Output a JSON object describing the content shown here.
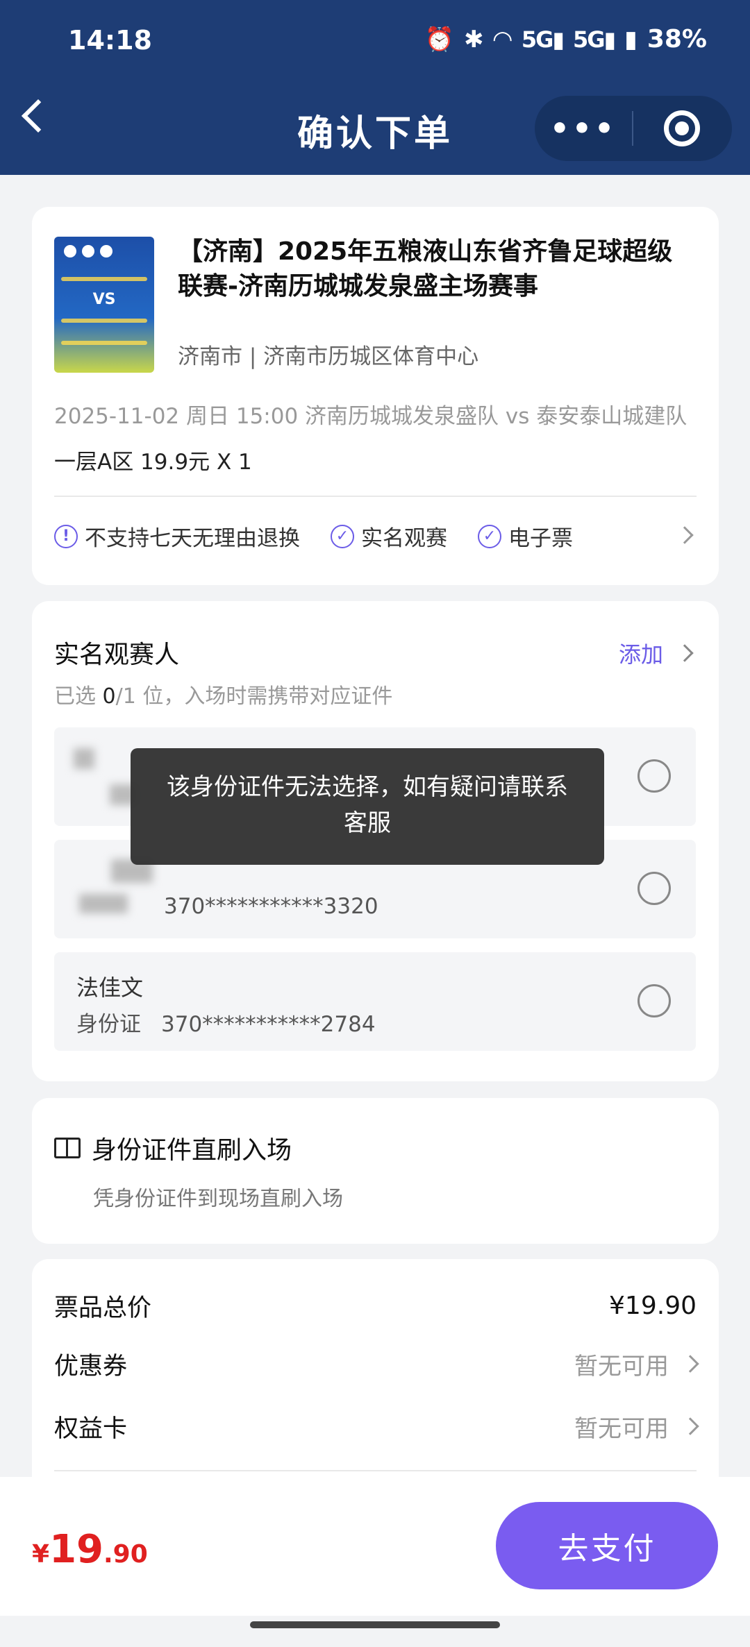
{
  "status_bar": {
    "time": "14:18",
    "battery": "38%"
  },
  "header": {
    "title": "确认下单",
    "menu_dots": "•••"
  },
  "event": {
    "title": "【济南】2025年五粮液山东省齐鲁足球超级联赛-济南历城城发泉盛主场赛事",
    "venue": "济南市 | 济南市历城区体育中心",
    "time_and_match": "2025-11-02 周日 15:00 济南历城城发泉盛队 vs 泰安泰山城建队",
    "seat": "一层A区 19.9元 X 1",
    "tags": [
      {
        "icon": "info-icon",
        "label": "不支持七天无理由退换"
      },
      {
        "icon": "check-circle-icon",
        "label": "实名观赛"
      },
      {
        "icon": "check-circle-icon",
        "label": "电子票"
      }
    ]
  },
  "attendees": {
    "title": "实名观赛人",
    "add_label": "添加",
    "subtitle_prefix": "已选 ",
    "selected": "0",
    "subtitle_suffix": "/1 位，入场时需携带对应证件",
    "list": [
      {
        "name": "",
        "id_type": "",
        "id_number": ""
      },
      {
        "name": "",
        "id_type": "",
        "id_number": "370***********3320"
      },
      {
        "name": "法佳文",
        "id_type": "身份证",
        "id_number": "370***********2784"
      }
    ]
  },
  "toast": {
    "message": "该身份证件无法选择，如有疑问请联系客服"
  },
  "entry": {
    "title": "身份证件直刷入场",
    "subtitle": "凭身份证件到现场直刷入场"
  },
  "pricing": {
    "total_label": "票品总价",
    "total_value": "¥19.90",
    "coupon_label": "优惠券",
    "coupon_value": "暂无可用",
    "card_label": "权益卡",
    "card_value": "暂无可用"
  },
  "bottom_bar": {
    "currency": "¥",
    "amount_int": "19",
    "amount_dec": ".90",
    "pay_label": "去支付"
  },
  "colors": {
    "header": "#1e3d75",
    "accent": "#6b5ce7",
    "pay_button": "#7a5cf0",
    "price": "#e02020"
  }
}
